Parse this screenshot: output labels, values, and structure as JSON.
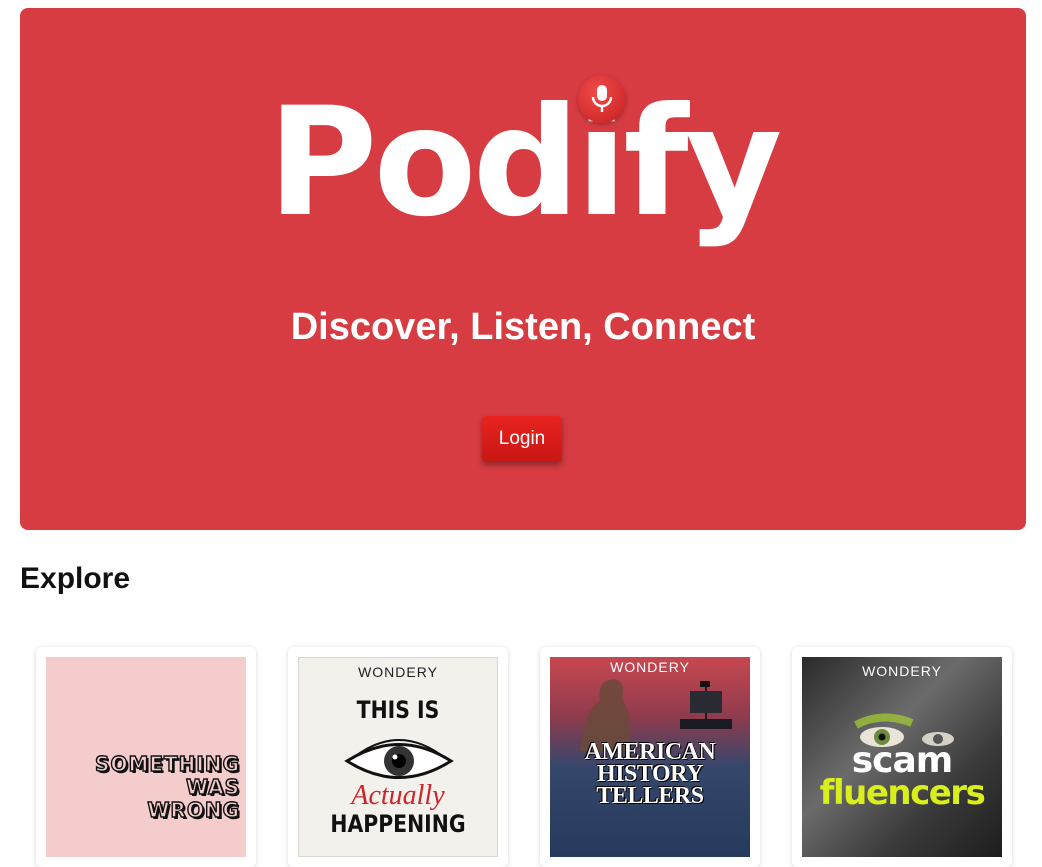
{
  "hero": {
    "logo": "Podify",
    "tagline": "Discover, Listen, Connect",
    "login_label": "Login",
    "background": "#d63c42",
    "logo_icon": "microphone-icon"
  },
  "explore": {
    "title": "Explore",
    "podcasts": [
      {
        "title_lines": [
          "SOMETHING",
          "WAS",
          "WRONG"
        ],
        "background": "#f4cccc"
      },
      {
        "brand": "WONDERY",
        "line1": "THIS IS",
        "script": "Actually",
        "line2": "HAPPENING"
      },
      {
        "brand": "WONDERY",
        "title_lines": [
          "AMERICAN",
          "HISTORY",
          "TELLERS"
        ]
      },
      {
        "brand": "WONDERY",
        "line1": "scam",
        "line2": "fluencers"
      }
    ]
  }
}
